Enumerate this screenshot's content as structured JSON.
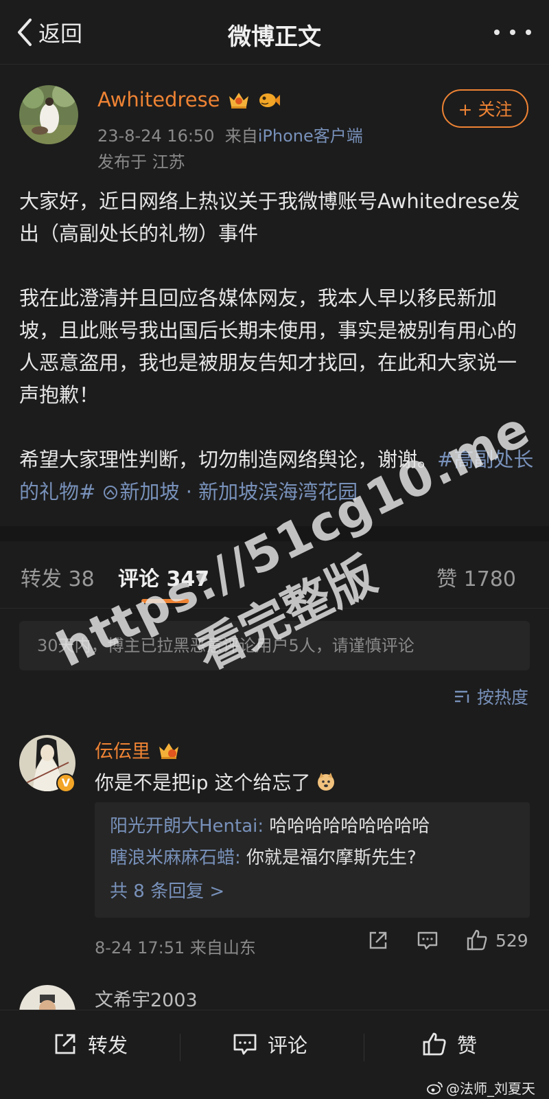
{
  "header": {
    "back_label": "返回",
    "title": "微博正文"
  },
  "post": {
    "username": "Awhitedrese",
    "follow_label": "+ 关注",
    "time": "23-8-24 16:50",
    "source_prefix": "来自",
    "source": "iPhone客户端",
    "location": "发布于 江苏",
    "paragraph1": "大家好，近日网络上热议关于我微博账号Awhitedrese发出（高副处长的礼物）事件",
    "paragraph2": "我在此澄清并且回应各媒体网友，我本人早以移民新加坡，且此账号我出国后长期未使用，事实是被别有用心的人恶意盗用，我也是被朋友告知才找回，在此和大家说一声抱歉！",
    "paragraph3": "希望大家理性判断，切勿制造网络舆论，谢谢。",
    "hashtag": "#高副处长的礼物#",
    "place": "新加坡 · 新加坡滨海湾花园"
  },
  "tabs": {
    "repost": "转发 38",
    "comment": "评论 347",
    "like": "赞 1780"
  },
  "comments": {
    "notice": "30天内，博主已拉黑恶意评论用户5人，请谨慎评论",
    "sort_label": "按热度",
    "items": [
      {
        "name": "伝伝里",
        "text": "你是不是把ip 这个给忘了",
        "replies": [
          {
            "name": "阳光开朗大Hentai:",
            "text": " 哈哈哈哈哈哈哈哈哈"
          },
          {
            "name": "瞎浪米麻麻石蜡:",
            "text": " 你就是福尔摩斯先生?"
          }
        ],
        "more_replies": "共 8 条回复 >",
        "meta": "8-24 17:51 来自山东",
        "likes": "529"
      },
      {
        "name": "文希宇2003"
      }
    ]
  },
  "bottom": {
    "repost": "转发",
    "comment": "评论",
    "like": "赞",
    "corner_watermark": "@法师_刘夏天"
  },
  "watermark": {
    "line1": "https://51cg10.me",
    "line2": "看完整版"
  },
  "colors": {
    "accent": "#ee8334",
    "link": "#7891ba",
    "background": "#1c1c1c"
  }
}
